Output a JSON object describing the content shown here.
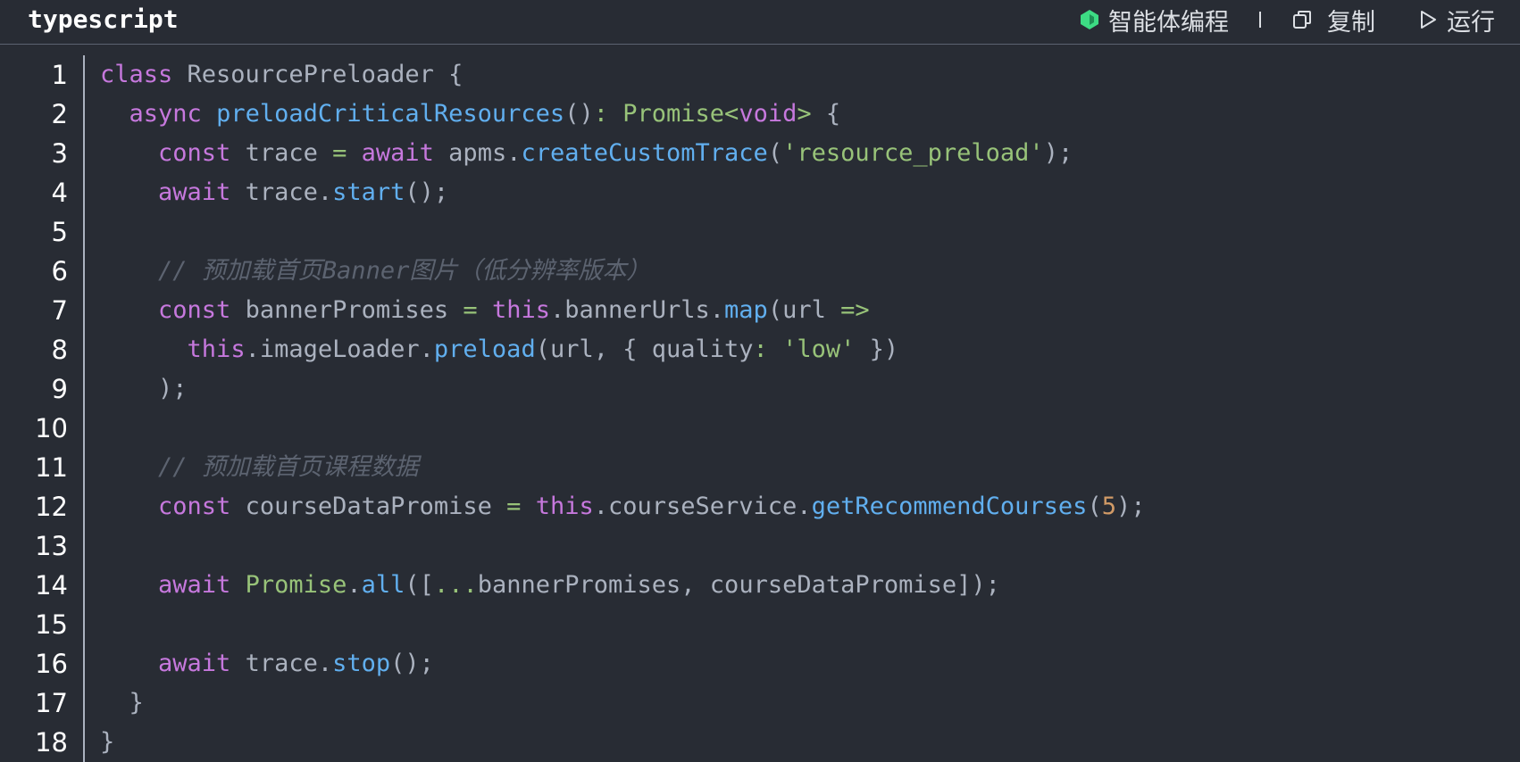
{
  "header": {
    "language": "typescript",
    "agent_label": "智能体编程",
    "copy_label": "复制",
    "run_label": "运行",
    "icons": [
      "agent-icon",
      "copy-icon",
      "run-icon"
    ]
  },
  "colors": {
    "background": "#282c34",
    "keyword": "#c678dd",
    "function": "#61afef",
    "string": "#98c379",
    "comment": "#5c6370",
    "text": "#abb2bf",
    "agent_icon": "#3ddc84"
  },
  "code": {
    "line_numbers": [
      "1",
      "2",
      "3",
      "4",
      "5",
      "6",
      "7",
      "8",
      "9",
      "10",
      "11",
      "12",
      "13",
      "14",
      "15",
      "16",
      "17",
      "18"
    ],
    "lines": [
      [
        {
          "t": "kw",
          "v": "class"
        },
        {
          "t": "pl",
          "v": " ResourcePreloader {"
        }
      ],
      [
        {
          "t": "pl",
          "v": "  "
        },
        {
          "t": "kw",
          "v": "async"
        },
        {
          "t": "pl",
          "v": " "
        },
        {
          "t": "fn",
          "v": "preloadCriticalResources"
        },
        {
          "t": "pl",
          "v": "()"
        },
        {
          "t": "op",
          "v": ":"
        },
        {
          "t": "pl",
          "v": " "
        },
        {
          "t": "ty",
          "v": "Promise"
        },
        {
          "t": "op",
          "v": "<"
        },
        {
          "t": "kw",
          "v": "void"
        },
        {
          "t": "op",
          "v": ">"
        },
        {
          "t": "pl",
          "v": " {"
        }
      ],
      [
        {
          "t": "pl",
          "v": "    "
        },
        {
          "t": "kw",
          "v": "const"
        },
        {
          "t": "pl",
          "v": " trace "
        },
        {
          "t": "op",
          "v": "="
        },
        {
          "t": "pl",
          "v": " "
        },
        {
          "t": "kw",
          "v": "await"
        },
        {
          "t": "pl",
          "v": " apms."
        },
        {
          "t": "fn",
          "v": "createCustomTrace"
        },
        {
          "t": "pl",
          "v": "("
        },
        {
          "t": "str",
          "v": "'resource_preload'"
        },
        {
          "t": "pl",
          "v": ");"
        }
      ],
      [
        {
          "t": "pl",
          "v": "    "
        },
        {
          "t": "kw",
          "v": "await"
        },
        {
          "t": "pl",
          "v": " trace."
        },
        {
          "t": "fn",
          "v": "start"
        },
        {
          "t": "pl",
          "v": "();"
        }
      ],
      [],
      [
        {
          "t": "pl",
          "v": "    "
        },
        {
          "t": "cm",
          "v": "// 预加载首页Banner图片（低分辨率版本）"
        }
      ],
      [
        {
          "t": "pl",
          "v": "    "
        },
        {
          "t": "kw",
          "v": "const"
        },
        {
          "t": "pl",
          "v": " bannerPromises "
        },
        {
          "t": "op",
          "v": "="
        },
        {
          "t": "pl",
          "v": " "
        },
        {
          "t": "kw",
          "v": "this"
        },
        {
          "t": "pl",
          "v": ".bannerUrls."
        },
        {
          "t": "fn",
          "v": "map"
        },
        {
          "t": "pl",
          "v": "(url "
        },
        {
          "t": "op",
          "v": "=>"
        }
      ],
      [
        {
          "t": "pl",
          "v": "      "
        },
        {
          "t": "kw",
          "v": "this"
        },
        {
          "t": "pl",
          "v": ".imageLoader."
        },
        {
          "t": "fn",
          "v": "preload"
        },
        {
          "t": "pl",
          "v": "(url, { quality"
        },
        {
          "t": "op",
          "v": ":"
        },
        {
          "t": "pl",
          "v": " "
        },
        {
          "t": "str",
          "v": "'low'"
        },
        {
          "t": "pl",
          "v": " })"
        }
      ],
      [
        {
          "t": "pl",
          "v": "    );"
        }
      ],
      [],
      [
        {
          "t": "pl",
          "v": "    "
        },
        {
          "t": "cm",
          "v": "// 预加载首页课程数据"
        }
      ],
      [
        {
          "t": "pl",
          "v": "    "
        },
        {
          "t": "kw",
          "v": "const"
        },
        {
          "t": "pl",
          "v": " courseDataPromise "
        },
        {
          "t": "op",
          "v": "="
        },
        {
          "t": "pl",
          "v": " "
        },
        {
          "t": "kw",
          "v": "this"
        },
        {
          "t": "pl",
          "v": ".courseService."
        },
        {
          "t": "fn",
          "v": "getRecommendCourses"
        },
        {
          "t": "pl",
          "v": "("
        },
        {
          "t": "num",
          "v": "5"
        },
        {
          "t": "pl",
          "v": ");"
        }
      ],
      [],
      [
        {
          "t": "pl",
          "v": "    "
        },
        {
          "t": "kw",
          "v": "await"
        },
        {
          "t": "pl",
          "v": " "
        },
        {
          "t": "ty",
          "v": "Promise"
        },
        {
          "t": "pl",
          "v": "."
        },
        {
          "t": "fn",
          "v": "all"
        },
        {
          "t": "pl",
          "v": "(["
        },
        {
          "t": "op",
          "v": "..."
        },
        {
          "t": "pl",
          "v": "bannerPromises, courseDataPromise]);"
        }
      ],
      [],
      [
        {
          "t": "pl",
          "v": "    "
        },
        {
          "t": "kw",
          "v": "await"
        },
        {
          "t": "pl",
          "v": " trace."
        },
        {
          "t": "fn",
          "v": "stop"
        },
        {
          "t": "pl",
          "v": "();"
        }
      ],
      [
        {
          "t": "pl",
          "v": "  }"
        }
      ],
      [
        {
          "t": "pl",
          "v": "}"
        }
      ]
    ]
  }
}
